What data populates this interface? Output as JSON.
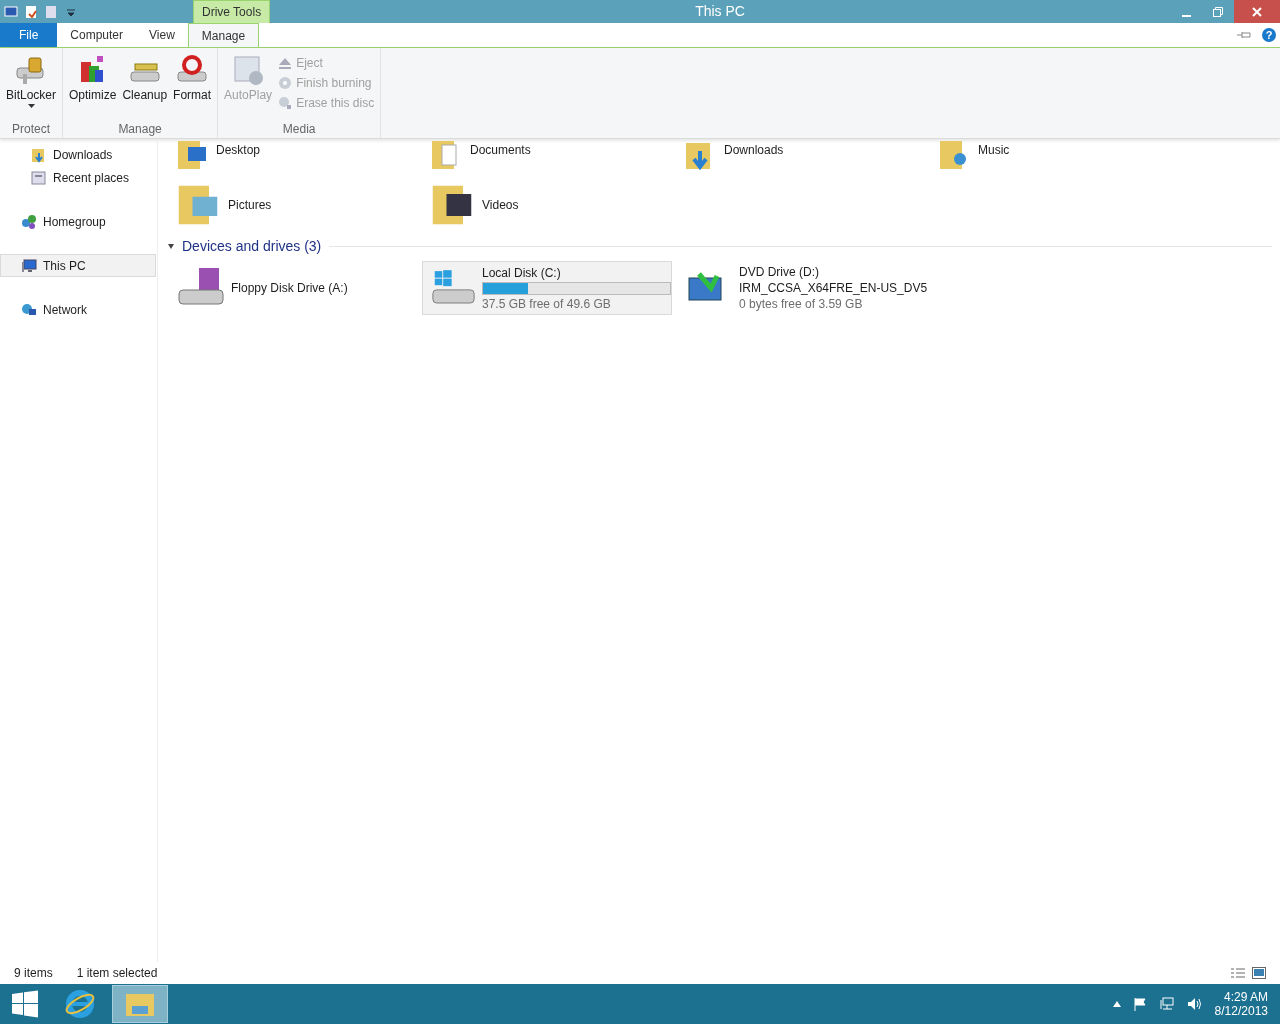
{
  "title_bar": {
    "context_tab": "Drive Tools",
    "title": "This PC"
  },
  "ribbon": {
    "tabs": [
      {
        "label": "File",
        "kind": "file",
        "selected": false
      },
      {
        "label": "Computer",
        "kind": "tab",
        "selected": false
      },
      {
        "label": "View",
        "kind": "tab",
        "selected": false
      },
      {
        "label": "Manage",
        "kind": "tab",
        "selected": true
      }
    ],
    "help": "?",
    "groups": [
      {
        "label": "Protect",
        "commands": [
          {
            "label": "BitLocker",
            "kind": "large",
            "dropdown": true,
            "disabled": false
          }
        ]
      },
      {
        "label": "Manage",
        "commands": [
          {
            "label": "Optimize",
            "kind": "large",
            "disabled": false
          },
          {
            "label": "Cleanup",
            "kind": "large",
            "disabled": false
          },
          {
            "label": "Format",
            "kind": "large",
            "disabled": false
          }
        ]
      },
      {
        "label": "Media",
        "commands": [
          {
            "label": "AutoPlay",
            "kind": "large",
            "disabled": true
          },
          {
            "label": "Eject",
            "kind": "small",
            "disabled": true
          },
          {
            "label": "Finish burning",
            "kind": "small",
            "disabled": true
          },
          {
            "label": "Erase this disc",
            "kind": "small",
            "disabled": true
          }
        ]
      }
    ]
  },
  "nav": {
    "items": [
      {
        "children": [
          {
            "label": "Downloads",
            "selected": false
          },
          {
            "label": "Recent places",
            "selected": false
          }
        ]
      },
      {
        "label": "Homegroup",
        "selected": false
      },
      {
        "label": "This PC",
        "selected": true
      },
      {
        "label": "Network",
        "selected": false
      }
    ]
  },
  "folders": [
    {
      "label": "Desktop"
    },
    {
      "label": "Documents"
    },
    {
      "label": "Downloads"
    },
    {
      "label": "Music"
    },
    {
      "label": "Pictures"
    },
    {
      "label": "Videos"
    }
  ],
  "devices": {
    "header": "Devices and drives (3)",
    "expanded": true,
    "drives": [
      {
        "kind": "plain",
        "name": "Floppy Disk Drive (A:)",
        "selected": false
      },
      {
        "kind": "bar",
        "name": "Local Disk (C:)",
        "level": 0.24,
        "free": "37.5 GB free of 49.6 GB",
        "selected": true
      },
      {
        "kind": "label",
        "name": "DVD Drive (D:)",
        "volume": "IRM_CCSA_X64FRE_EN-US_DV5",
        "free": "0 bytes free of 3.59 GB",
        "selected": false
      }
    ]
  },
  "status_bar": {
    "count": "9 items",
    "selection": "1 item selected"
  },
  "taskbar": {
    "apps": [
      {
        "selected": false
      },
      {
        "selected": true
      }
    ],
    "time": "4:29 AM",
    "date": "8/12/2013"
  }
}
